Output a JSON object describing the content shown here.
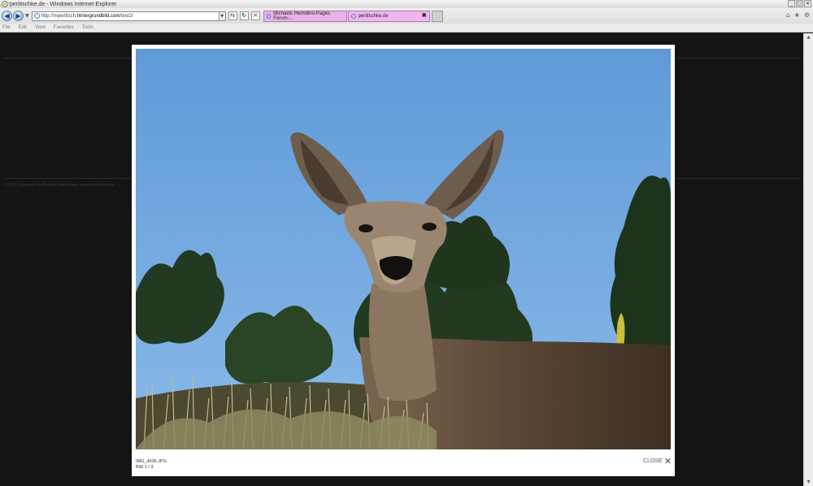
{
  "window": {
    "title": "perlitschke.de - Windows Internet Explorer",
    "minimize_glyph": "_",
    "maximize_glyph": "□",
    "close_glyph": "✕"
  },
  "nav": {
    "back_glyph": "◀",
    "forward_glyph": "▶",
    "url_prefix": "http://mperlitsch.",
    "url_host": "hintergrundbild.com",
    "url_suffix": "/test2/",
    "refresh_glyph": "↻",
    "go_glyph": "⇆",
    "stop_glyph": "✕"
  },
  "tabs": [
    {
      "label": "Michaels Heimdino-Pages Forum-..."
    },
    {
      "label": "perlitschke.de",
      "close_glyph": "✖"
    }
  ],
  "toolbar_right": {
    "home_glyph": "⌂",
    "favorites_glyph": "★",
    "tools_glyph": "⚙"
  },
  "menu": [
    "File",
    "Edit",
    "View",
    "Favorites",
    "Tools"
  ],
  "page": {
    "footer": "(c) 2015 powered by Michael Perlitschke, www.perlitschke.de"
  },
  "lightbox": {
    "filename": "IMG_4436.JPG",
    "counter": "Bild 1 / 3",
    "close_label": "CLOSE",
    "close_glyph": "✕"
  },
  "colors": {
    "sky": "#6aa3dd",
    "page_bg": "#1b1b1b",
    "tab_active": "#f0b6ee"
  }
}
